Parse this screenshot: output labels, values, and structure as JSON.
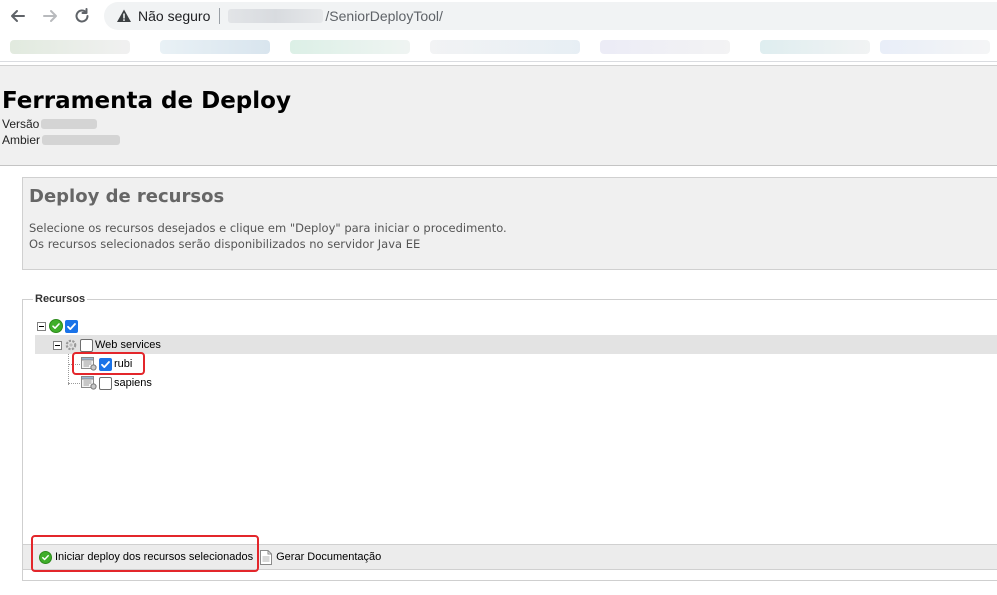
{
  "browser": {
    "security_label": "Não seguro",
    "url_path": "/SeniorDeployTool/"
  },
  "header": {
    "title": "Ferramenta de Deploy",
    "version_label": "Versão",
    "environment_label": "Ambier"
  },
  "deploy_panel": {
    "title": "Deploy de recursos",
    "description_line1": "Selecione os recursos desejados e clique em \"Deploy\" para iniciar o procedimento.",
    "description_line2": "Os recursos selecionados serão disponibilizados no servidor Java EE"
  },
  "resources": {
    "legend": "Recursos",
    "root_checked": true,
    "group": {
      "label": "Web services",
      "checked": false
    },
    "items": [
      {
        "label": "rubi",
        "checked": true
      },
      {
        "label": "sapiens",
        "checked": false
      }
    ]
  },
  "toolbar": {
    "deploy_label": "Iniciar deploy dos recursos selecionados",
    "docs_label": "Gerar Documentação"
  },
  "colors": {
    "highlight": "#e3262b",
    "ok_green": "#3fae2a",
    "checkbox_blue": "#1a73e8"
  }
}
